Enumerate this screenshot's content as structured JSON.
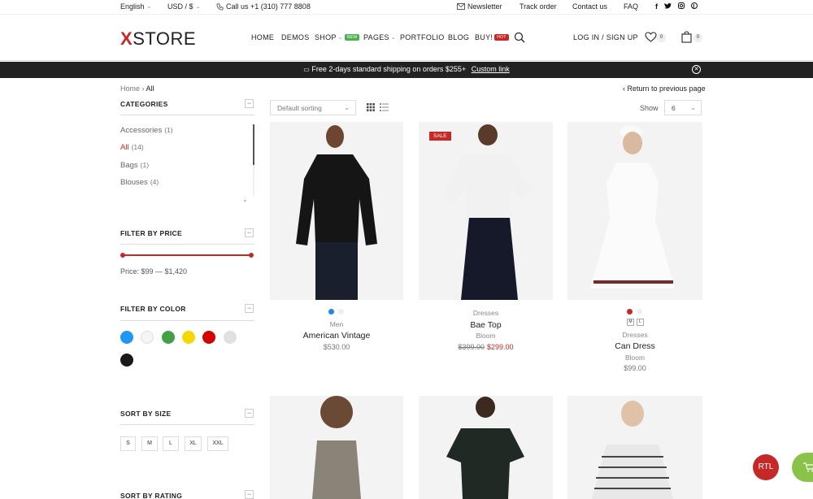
{
  "topbar": {
    "language": "English",
    "currency": "USD / $",
    "phone": "Call us +1 (310) 777 8808",
    "newsletter": "Newsletter",
    "track_order": "Track order",
    "contact_us": "Contact us",
    "faq": "FAQ",
    "social": [
      "f",
      "t",
      "ig",
      "p"
    ]
  },
  "header": {
    "logo_mark": "X",
    "logo_text": "STORE",
    "nav": {
      "home": "HOME",
      "demos": "DEMOS",
      "shop": "SHOP",
      "shop_badge": "NEW",
      "pages": "PAGES",
      "portfolio": "PORTFOLIO",
      "blog": "BLOG",
      "buy": "BUY!",
      "buy_badge": "HOT"
    },
    "login": "LOG IN / SIGN UP",
    "wishlist_count": "0",
    "cart_count": "0"
  },
  "promo": {
    "text": "Free 2-days standard shipping on orders $255+",
    "link": "Custom link"
  },
  "breadcrumb": {
    "home": "Home",
    "sep": "›",
    "current": "All"
  },
  "sidebar": {
    "categories_title": "CATEGORIES",
    "categories": [
      {
        "label": "Accessories",
        "count": "(1)"
      },
      {
        "label": "All",
        "count": "(14)"
      },
      {
        "label": "Bags",
        "count": "(1)"
      },
      {
        "label": "Blouses",
        "count": "(4)"
      }
    ],
    "price_title": "FILTER BY PRICE",
    "price_text": "Price: $99 — $1,420",
    "color_title": "FILTER BY COLOR",
    "colors": [
      "#2196f3",
      "#f5f5f5",
      "#43a047",
      "#f4d800",
      "#d50000",
      "#e0e0e0",
      "#1a1a1a"
    ],
    "size_title": "SORT BY SIZE",
    "sizes": [
      "S",
      "M",
      "L",
      "XL",
      "XXL"
    ],
    "rating_title": "SORT BY RATING"
  },
  "toolbar": {
    "sort_value": "Default sorting",
    "return_link": "Return to previous page",
    "show_label": "Show",
    "show_value": "6"
  },
  "products": [
    {
      "category": "Men",
      "name": "American Vintage",
      "price": "$530.00"
    },
    {
      "category": "Dresses",
      "name": "Bae Top",
      "brand": "Bloom",
      "old_price": "$399.00",
      "price": "$299.00",
      "badge": "SALE"
    },
    {
      "category": "Dresses",
      "name": "Can Dress",
      "brand": "Bloom",
      "price": "$99.00",
      "sizes": [
        "M",
        "L"
      ]
    }
  ],
  "floating": {
    "rtl": "RTL"
  },
  "colors": {
    "accent": "#c62828",
    "promo_bg": "#222222",
    "fab_green": "#8bc34a"
  }
}
